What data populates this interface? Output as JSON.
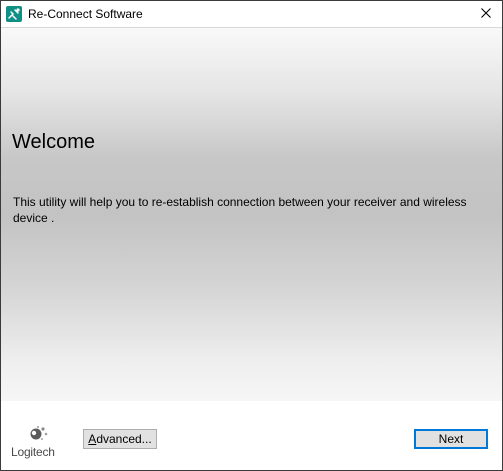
{
  "window": {
    "title": "Re-Connect Software",
    "app_icon": "logitech-reconnect-icon",
    "close_icon": "close-icon"
  },
  "main": {
    "heading": "Welcome",
    "description": "This utility will help you to re-establish connection between your receiver and wireless device ."
  },
  "footer": {
    "logo_text": "Logitech",
    "advanced_label_rest": "dvanced...",
    "advanced_label_accel": "A",
    "next_label": "Next"
  },
  "colors": {
    "app_icon_bg": "#0f8f86",
    "default_button_border": "#0078d7",
    "button_face": "#e1e1e1"
  }
}
